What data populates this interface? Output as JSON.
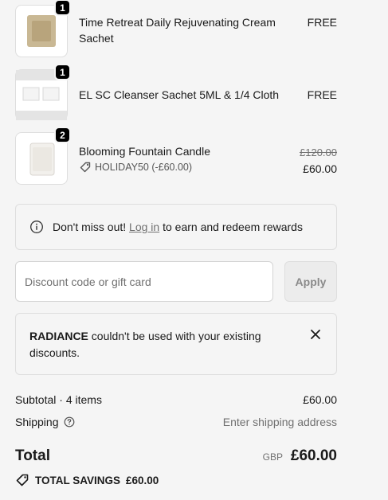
{
  "items": [
    {
      "qty": "1",
      "title": "Time Retreat Daily Rejuvenating Cream Sachet",
      "price": "FREE"
    },
    {
      "qty": "1",
      "title": "EL SC Cleanser Sachet 5ML & 1/4 Cloth",
      "price": "FREE"
    },
    {
      "qty": "2",
      "title": "Blooming Fountain Candle",
      "original_price": "£120.00",
      "price": "£60.00",
      "discount_code": "HOLIDAY50 (-£60.00)"
    }
  ],
  "notice": {
    "prefix": "Don't miss out!",
    "link": "Log in",
    "suffix": "to earn and redeem rewards"
  },
  "discount": {
    "placeholder": "Discount code or gift card",
    "value": "",
    "apply_label": "Apply"
  },
  "alert": {
    "code": "RADIANCE",
    "message": "couldn't be used with your existing discounts."
  },
  "summary": {
    "subtotal_label": "Subtotal · 4 items",
    "subtotal_value": "£60.00",
    "shipping_label": "Shipping",
    "shipping_value": "Enter shipping address",
    "total_label": "Total",
    "currency": "GBP",
    "total_value": "£60.00",
    "savings_label": "TOTAL SAVINGS",
    "savings_value": "£60.00"
  },
  "icons": {
    "info": "info-icon",
    "tag": "tag-icon",
    "close": "close-icon",
    "help": "help-icon"
  }
}
